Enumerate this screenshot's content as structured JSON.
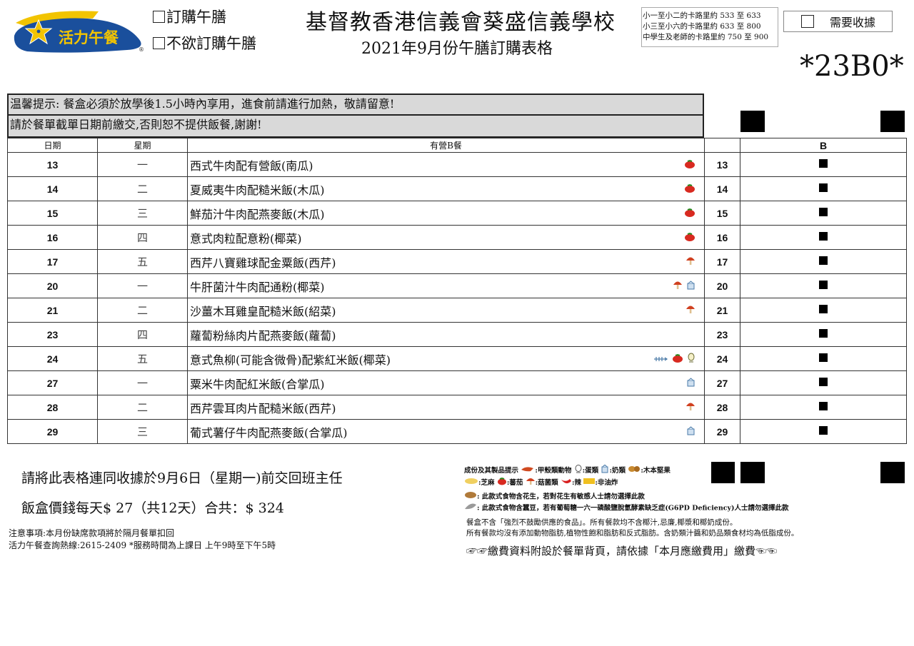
{
  "logo": {
    "text": "活力午餐",
    "mark": "®",
    "colors": {
      "blue": "#1a4f9c",
      "yellow": "#f2c400"
    }
  },
  "options": {
    "order": "訂購午膳",
    "no_order": "不欲訂購午膳"
  },
  "school_name": "基督教香港信義會葵盛信義學校",
  "form_title": "2021年9月份午膳訂購表格",
  "calories": [
    "小一至小二的卡路里約 533 至 633",
    "小三至小六的卡路里約 633 至 800",
    "中學生及老師的卡路里約 750 至 900"
  ],
  "receipt_label": "需要收據",
  "code": "*23B0*",
  "notices": [
    "温馨提示: 餐盒必須於放學後1.5小時內享用，進食前請進行加熱，敬請留意!",
    "請於餐單截單日期前繳交,否則恕不提供飯餐,謝謝!"
  ],
  "table": {
    "headers": {
      "date": "日期",
      "weekday": "星期",
      "dish": "有營B餐",
      "b": "B"
    },
    "rows": [
      {
        "date": "13",
        "weekday": "一",
        "dish": "西式牛肉配有營飯(南瓜)",
        "icons": [
          "tomato-icon"
        ]
      },
      {
        "date": "14",
        "weekday": "二",
        "dish": "夏威夷牛肉配糙米飯(木瓜)",
        "icons": [
          "tomato-icon"
        ]
      },
      {
        "date": "15",
        "weekday": "三",
        "dish": "鮮茄汁牛肉配燕麥飯(木瓜)",
        "icons": [
          "tomato-icon"
        ]
      },
      {
        "date": "16",
        "weekday": "四",
        "dish": "意式肉粒配意粉(椰菜)",
        "icons": [
          "tomato-icon"
        ]
      },
      {
        "date": "17",
        "weekday": "五",
        "dish": "西芹八寶雞球配金粟飯(西芹)",
        "icons": [
          "mushroom-icon"
        ]
      },
      {
        "date": "20",
        "weekday": "一",
        "dish": "牛肝菌汁牛肉配通粉(椰菜)",
        "icons": [
          "mushroom-icon",
          "milk-icon"
        ]
      },
      {
        "date": "21",
        "weekday": "二",
        "dish": "沙薑木耳雞皇配糙米飯(紹菜)",
        "icons": [
          "mushroom-icon"
        ]
      },
      {
        "date": "23",
        "weekday": "四",
        "dish": "蘿蔔粉絲肉片配燕麥飯(蘿蔔)",
        "icons": []
      },
      {
        "date": "24",
        "weekday": "五",
        "dish": "意式魚柳(可能含微骨)配紫紅米飯(椰菜)",
        "icons": [
          "fish-icon",
          "tomato-icon",
          "egg-icon"
        ]
      },
      {
        "date": "27",
        "weekday": "一",
        "dish": "粟米牛肉配紅米飯(合掌瓜)",
        "icons": [
          "milk-icon"
        ]
      },
      {
        "date": "28",
        "weekday": "二",
        "dish": "西芹雲耳肉片配糙米飯(西芹)",
        "icons": [
          "mushroom-icon"
        ]
      },
      {
        "date": "29",
        "weekday": "三",
        "dish": "葡式薯仔牛肉配燕麥飯(合掌瓜)",
        "icons": [
          "milk-icon"
        ]
      }
    ]
  },
  "submit_text": "請將此表格連同收據於9月6日（星期一)前交回班主任",
  "price_text": "飯盒價錢每天$ 27（共12天）合共：$ 324",
  "notes": [
    "注意事項:本月份缺席款項將於隔月餐單扣回",
    "活力午餐查詢熱線:2615-2409  *服務時間為上課日  上午9時至下午5時"
  ],
  "legend": {
    "title": "成份及其製品提示",
    "items": [
      ":甲殼類動物",
      ":蛋類",
      ":奶類",
      ":木本堅果",
      ":芝麻",
      ":蕃茄",
      ":菇菌類",
      ":辣",
      ":非油炸"
    ],
    "peanut": ": 此款式食物含花生，若對花生有敏感人士請勿選擇此款",
    "broadbean": ": 此款式食物含蠶豆，若有葡萄糖一六一磷酸鹽脫氫酵素缺乏症(G6PD Deficiency)人士請勿選擇此款",
    "info1": "餐盒不含「強烈不鼓勵供應的食品」。所有餐款均不含椰汁,忌廉,椰漿和椰奶成份。",
    "info2": "所有餐款均沒有添加動物脂肪,植物性飽和脂肪和反式脂肪。含奶類汁醬和奶品類食材均為低脂成份。"
  },
  "payment_text": "繳費資料附設於餐單背頁，請依據「本月應繳費用」繳費"
}
